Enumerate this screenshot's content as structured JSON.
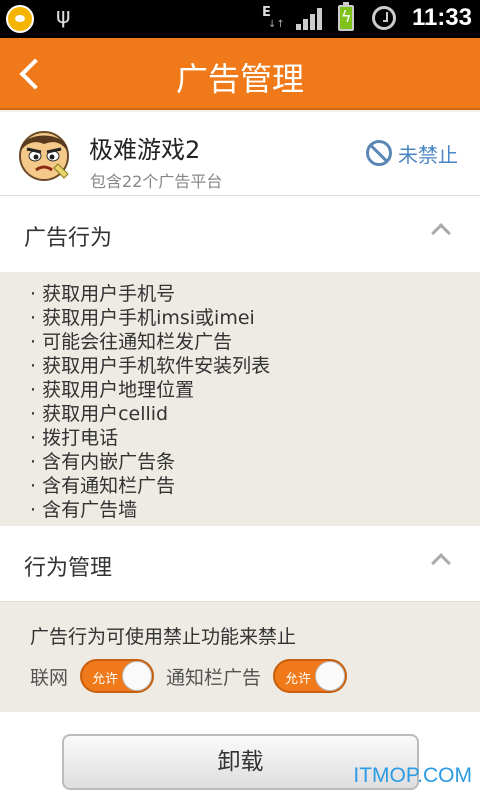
{
  "status_bar": {
    "time": "11:33",
    "network_type": "E",
    "battery_color": "#7fc21c",
    "icons": [
      "app-notification-icon",
      "usb-icon",
      "signal-icon",
      "battery-charging-icon",
      "alarm-icon"
    ]
  },
  "title_bar": {
    "title": "广告管理",
    "background": "#f07a1a",
    "back_icon": "back-arrow-icon"
  },
  "app": {
    "name": "极难游戏2",
    "subtitle": "包含22个广告平台",
    "status_label": "未禁止",
    "status_icon": "ban-icon",
    "icon": "app-face-icon"
  },
  "ad_behavior": {
    "title": "广告行为",
    "items": [
      "· 获取用户手机号",
      "· 获取用户手机imsi或imei",
      "· 可能会往通知栏发广告",
      "· 获取用户手机软件安装列表",
      "· 获取用户地理位置",
      "· 获取用户cellid",
      "· 拨打电话",
      "· 含有内嵌广告条",
      "· 含有通知栏广告",
      "· 含有广告墙"
    ]
  },
  "behavior_management": {
    "title": "行为管理",
    "description": "广告行为可使用禁止功能来禁止",
    "toggles": [
      {
        "label": "联网",
        "state_text": "允许"
      },
      {
        "label": "通知栏广告",
        "state_text": "允许"
      }
    ]
  },
  "bottom": {
    "uninstall_label": "卸载"
  },
  "watermark": "ITMOP.COM"
}
